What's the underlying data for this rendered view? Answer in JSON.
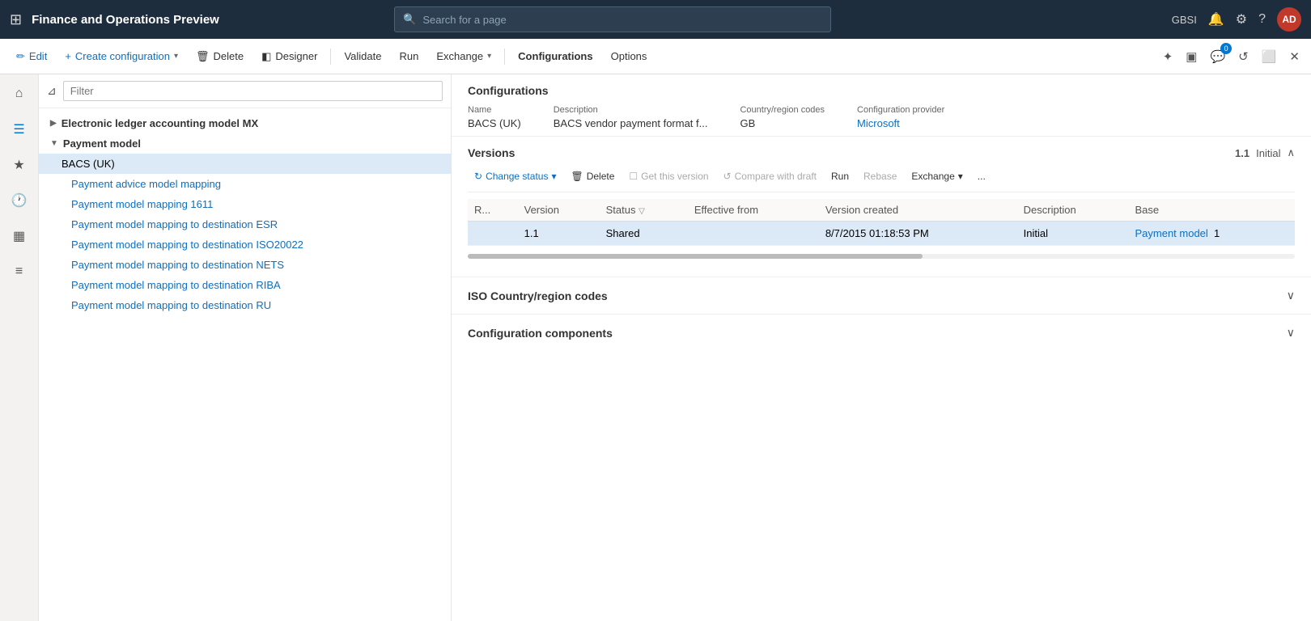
{
  "app": {
    "title": "Finance and Operations Preview",
    "search_placeholder": "Search for a page",
    "user": "GBSI",
    "avatar": "AD"
  },
  "cmd_bar": {
    "edit_label": "Edit",
    "create_label": "Create configuration",
    "delete_label": "Delete",
    "designer_label": "Designer",
    "validate_label": "Validate",
    "run_label": "Run",
    "exchange_label": "Exchange",
    "configurations_label": "Configurations",
    "options_label": "Options",
    "badge_count": "0"
  },
  "tree": {
    "filter_placeholder": "Filter",
    "group1_label": "Electronic ledger accounting model MX",
    "group2_label": "Payment model",
    "items": [
      {
        "label": "BACS (UK)",
        "selected": true
      },
      {
        "label": "Payment advice model mapping",
        "selected": false
      },
      {
        "label": "Payment model mapping 1611",
        "selected": false
      },
      {
        "label": "Payment model mapping to destination ESR",
        "selected": false
      },
      {
        "label": "Payment model mapping to destination ISO20022",
        "selected": false
      },
      {
        "label": "Payment model mapping to destination NETS",
        "selected": false
      },
      {
        "label": "Payment model mapping to destination RIBA",
        "selected": false
      },
      {
        "label": "Payment model mapping to destination RU",
        "selected": false
      }
    ]
  },
  "detail": {
    "section_title": "Configurations",
    "fields": {
      "name_label": "Name",
      "name_value": "BACS (UK)",
      "description_label": "Description",
      "description_value": "BACS vendor payment format f...",
      "country_label": "Country/region codes",
      "country_value": "GB",
      "provider_label": "Configuration provider",
      "provider_value": "Microsoft"
    }
  },
  "versions": {
    "section_title": "Versions",
    "version_number": "1.1",
    "status_label": "Initial",
    "toolbar": {
      "change_status": "Change status",
      "delete": "Delete",
      "get_this_version": "Get this version",
      "compare_with_draft": "Compare with draft",
      "run": "Run",
      "rebase": "Rebase",
      "exchange": "Exchange",
      "more": "..."
    },
    "table": {
      "columns": [
        "R...",
        "Version",
        "Status",
        "Effective from",
        "Version created",
        "Description",
        "Base"
      ],
      "rows": [
        {
          "r": "",
          "version": "1.1",
          "status": "Shared",
          "effective_from": "",
          "version_created": "8/7/2015 01:18:53 PM",
          "description": "Initial",
          "base": "Payment model",
          "base_num": "1",
          "selected": true
        }
      ]
    }
  },
  "iso_section": {
    "title": "ISO Country/region codes"
  },
  "config_components": {
    "title": "Configuration components"
  }
}
